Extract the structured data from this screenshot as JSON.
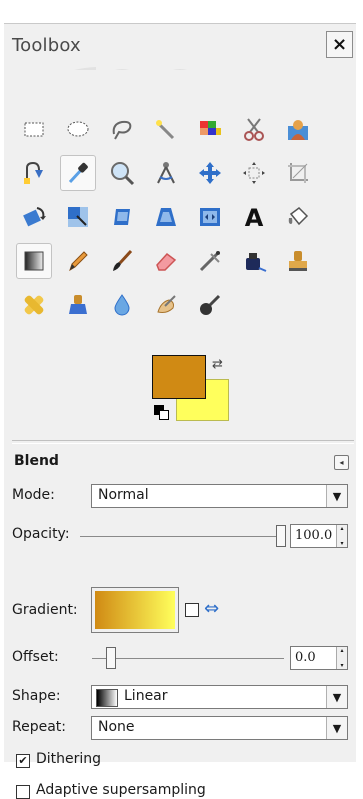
{
  "window": {
    "title": "Toolbox",
    "close_label": "×"
  },
  "tools": [
    {
      "name": "rect-select-icon"
    },
    {
      "name": "ellipse-select-icon"
    },
    {
      "name": "free-select-icon"
    },
    {
      "name": "fuzzy-select-icon"
    },
    {
      "name": "select-by-color-icon"
    },
    {
      "name": "scissors-select-icon"
    },
    {
      "name": "foreground-select-icon"
    },
    {
      "name": "paths-icon"
    },
    {
      "name": "color-picker-icon"
    },
    {
      "name": "zoom-icon"
    },
    {
      "name": "measure-icon"
    },
    {
      "name": "move-icon"
    },
    {
      "name": "align-icon"
    },
    {
      "name": "crop-icon"
    },
    {
      "name": "rotate-icon"
    },
    {
      "name": "scale-icon"
    },
    {
      "name": "shear-icon"
    },
    {
      "name": "perspective-icon"
    },
    {
      "name": "flip-icon"
    },
    {
      "name": "text-icon"
    },
    {
      "name": "bucket-fill-icon"
    },
    {
      "name": "blend-icon"
    },
    {
      "name": "pencil-icon"
    },
    {
      "name": "paintbrush-icon"
    },
    {
      "name": "eraser-icon"
    },
    {
      "name": "airbrush-icon"
    },
    {
      "name": "ink-icon"
    },
    {
      "name": "clone-icon"
    },
    {
      "name": "heal-icon"
    },
    {
      "name": "perspective-clone-icon"
    },
    {
      "name": "blur-icon"
    },
    {
      "name": "smudge-icon"
    },
    {
      "name": "dodge-burn-icon"
    }
  ],
  "selected_tool": "blend-icon",
  "colors": {
    "foreground": "#d08a14",
    "background": "#ffff5c"
  },
  "tool_options": {
    "title": "Blend",
    "mode": {
      "label": "Mode:",
      "value": "Normal"
    },
    "opacity": {
      "label": "Opacity:",
      "value": "100.0"
    },
    "gradient": {
      "label": "Gradient:"
    },
    "offset": {
      "label": "Offset:",
      "value": "0.0"
    },
    "shape": {
      "label": "Shape:",
      "value": "Linear"
    },
    "repeat": {
      "label": "Repeat:",
      "value": "None"
    },
    "dithering": {
      "label": "Dithering",
      "checked": true
    },
    "adaptive": {
      "label": "Adaptive supersampling",
      "checked": false
    }
  }
}
